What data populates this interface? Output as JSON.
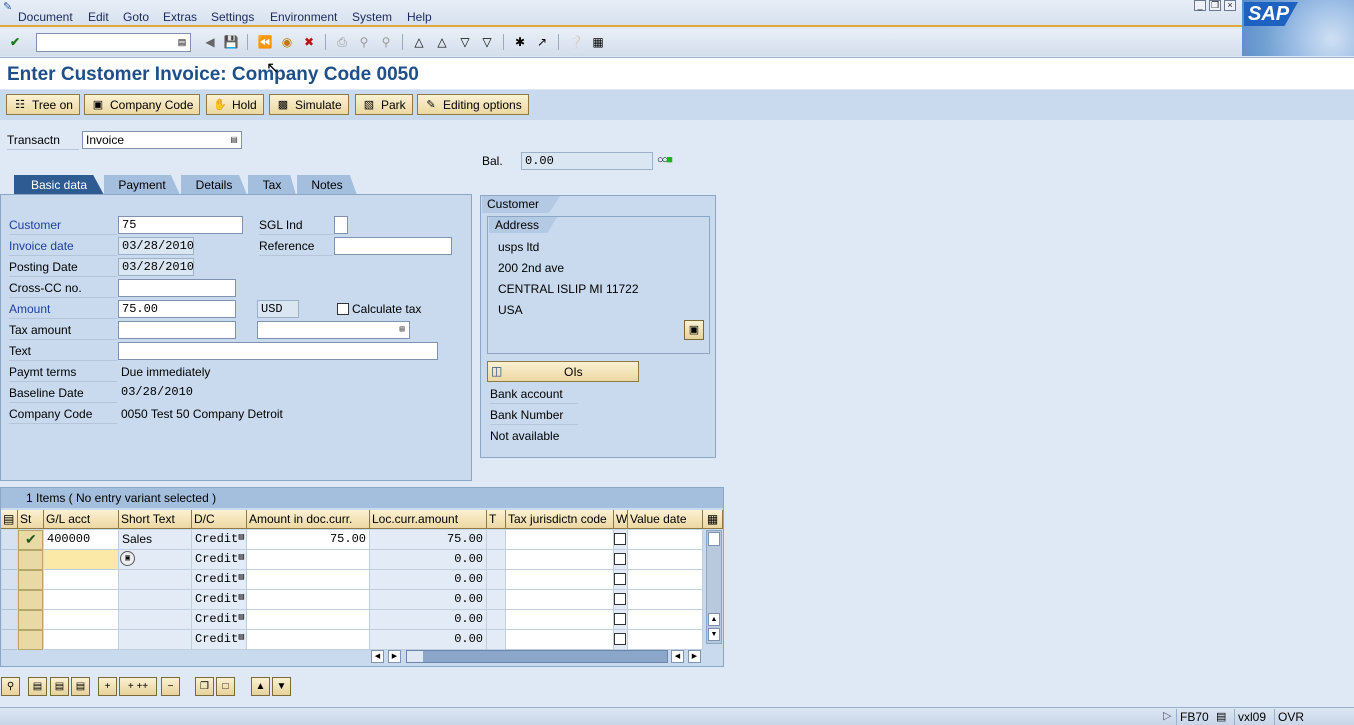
{
  "menu": [
    "Document",
    "Edit",
    "Goto",
    "Extras",
    "Settings",
    "Environment",
    "System",
    "Help"
  ],
  "logo_text": "SAP",
  "page_title": "Enter Customer Invoice: Company Code 0050",
  "app_toolbar": {
    "tree_on": "Tree on",
    "company_code": "Company Code",
    "hold": "Hold",
    "simulate": "Simulate",
    "park": "Park",
    "editing_options": "Editing options"
  },
  "header": {
    "transactn_label": "Transactn",
    "transactn_value": "Invoice",
    "bal_label": "Bal.",
    "bal_value": "0.00"
  },
  "tabs": [
    "Basic data",
    "Payment",
    "Details",
    "Tax",
    "Notes"
  ],
  "basic": {
    "customer_label": "Customer",
    "customer_value": "75",
    "sgl_label": "SGL Ind",
    "invoice_date_label": "Invoice date",
    "invoice_date_value": "03/28/2010",
    "reference_label": "Reference",
    "posting_date_label": "Posting Date",
    "posting_date_value": "03/28/2010",
    "crosscc_label": "Cross-CC no.",
    "amount_label": "Amount",
    "amount_value": "75.00",
    "currency": "USD",
    "calc_tax_label": "Calculate tax",
    "tax_amount_label": "Tax amount",
    "text_label": "Text",
    "paymt_terms_label": "Paymt terms",
    "paymt_terms_value": "Due immediately",
    "baseline_label": "Baseline Date",
    "baseline_value": "03/28/2010",
    "company_code_label": "Company Code",
    "company_code_value": "0050 Test 50 Company Detroit"
  },
  "customer_panel": {
    "tab": "Customer",
    "address_tab": "Address",
    "address": [
      "usps ltd",
      "200 2nd ave",
      "CENTRAL ISLIP MI  11722",
      "USA"
    ],
    "ois_label": "OIs",
    "bank_account": "Bank account",
    "bank_number": "Bank Number",
    "not_available": "Not available"
  },
  "items": {
    "title": "1 Items ( No entry variant selected )",
    "columns": [
      "St",
      "G/L acct",
      "Short Text",
      "D/C",
      "Amount in doc.curr.",
      "Loc.curr.amount",
      "T",
      "Tax jurisdictn code",
      "W",
      "Value date"
    ],
    "rows": [
      {
        "gl": "400000",
        "short": "Sales",
        "dc": "Credit",
        "amt": "75.00",
        "loc": "75.00"
      },
      {
        "gl": "",
        "short": "",
        "dc": "Credit",
        "amt": "",
        "loc": "0.00"
      },
      {
        "gl": "",
        "short": "",
        "dc": "Credit",
        "amt": "",
        "loc": "0.00"
      },
      {
        "gl": "",
        "short": "",
        "dc": "Credit",
        "amt": "",
        "loc": "0.00"
      },
      {
        "gl": "",
        "short": "",
        "dc": "Credit",
        "amt": "",
        "loc": "0.00"
      },
      {
        "gl": "",
        "short": "",
        "dc": "Credit",
        "amt": "",
        "loc": "0.00"
      }
    ]
  },
  "status": {
    "tcode": "FB70",
    "server": "vxl09",
    "mode": "OVR"
  }
}
